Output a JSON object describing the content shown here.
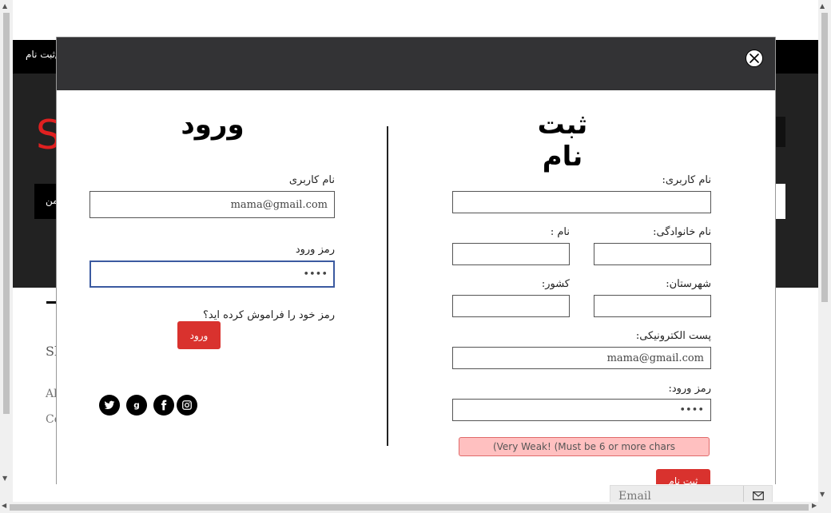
{
  "background": {
    "topbar_link": "ورود/ثبت نام",
    "logo_letter": "S",
    "nav_text": "من",
    "footer_heading": "Sh",
    "footer_link_a": "Al",
    "footer_link_b": "Co"
  },
  "modal": {
    "close_icon": "close-x-icon",
    "register": {
      "title": "ثبت نام",
      "username_label": "نام کاربری:",
      "lastname_label": "نام خانوادگی:",
      "firstname_label": "نام :",
      "city_label": "شهرستان:",
      "country_label": "کشور:",
      "email_label": "پست الکترونیکی:",
      "email_value": "mama@gmail.com",
      "password_label": "رمز ورود:",
      "password_value": "••••",
      "strength_text": "(Very Weak! (Must be 6 or more chars",
      "submit_label": "ثبت نام"
    },
    "login": {
      "title": "ورود",
      "username_label": "نام کاربری",
      "username_value": "mama@gmail.com",
      "password_label": "رمز ورود",
      "password_value": "••••",
      "forgot_text": "رمز خود را فراموش کرده اید؟",
      "submit_label": "ورود"
    },
    "social_icons": [
      "twitter-icon",
      "google-icon",
      "facebook-icon",
      "instagram-icon"
    ]
  },
  "newsletter": {
    "placeholder": "Email",
    "button_icon": "envelope-icon"
  },
  "colors": {
    "modal_header": "#333335",
    "accent_red": "#d9322e",
    "warning_bg": "#ffc0c0"
  }
}
